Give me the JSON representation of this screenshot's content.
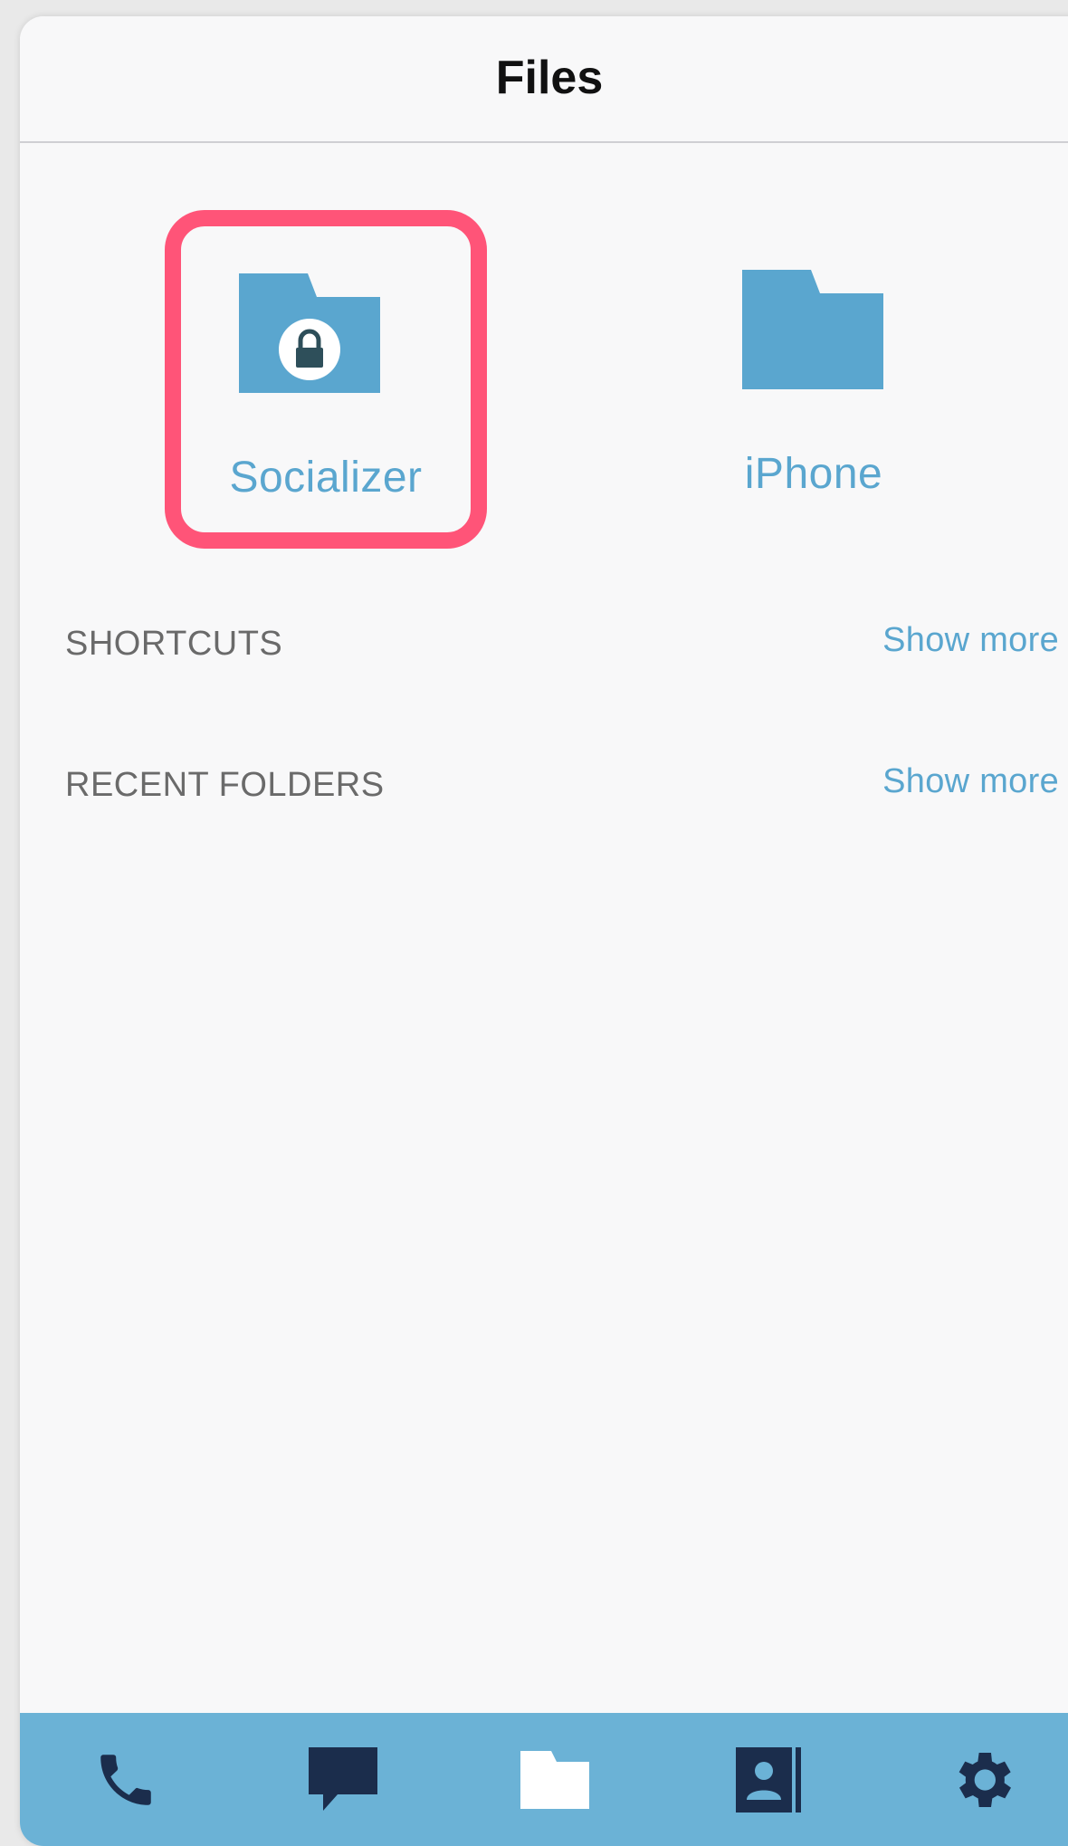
{
  "header": {
    "title": "Files"
  },
  "folders": [
    {
      "label": "Socializer",
      "icon": "locked-folder-icon",
      "highlighted": true
    },
    {
      "label": "iPhone",
      "icon": "folder-icon",
      "highlighted": false
    }
  ],
  "sections": [
    {
      "label": "SHORTCUTS",
      "action": "Show more"
    },
    {
      "label": "RECENT FOLDERS",
      "action": "Show more"
    }
  ],
  "tabbar": {
    "items": [
      "phone-icon",
      "chat-icon",
      "folder-icon",
      "contacts-icon",
      "gear-icon"
    ],
    "active": "folder-icon"
  },
  "colors": {
    "accent": "#5aa6cf",
    "tabbar": "#6bb2d6",
    "tab_icon": "#1b2d4c",
    "highlight": "#ff5478"
  }
}
